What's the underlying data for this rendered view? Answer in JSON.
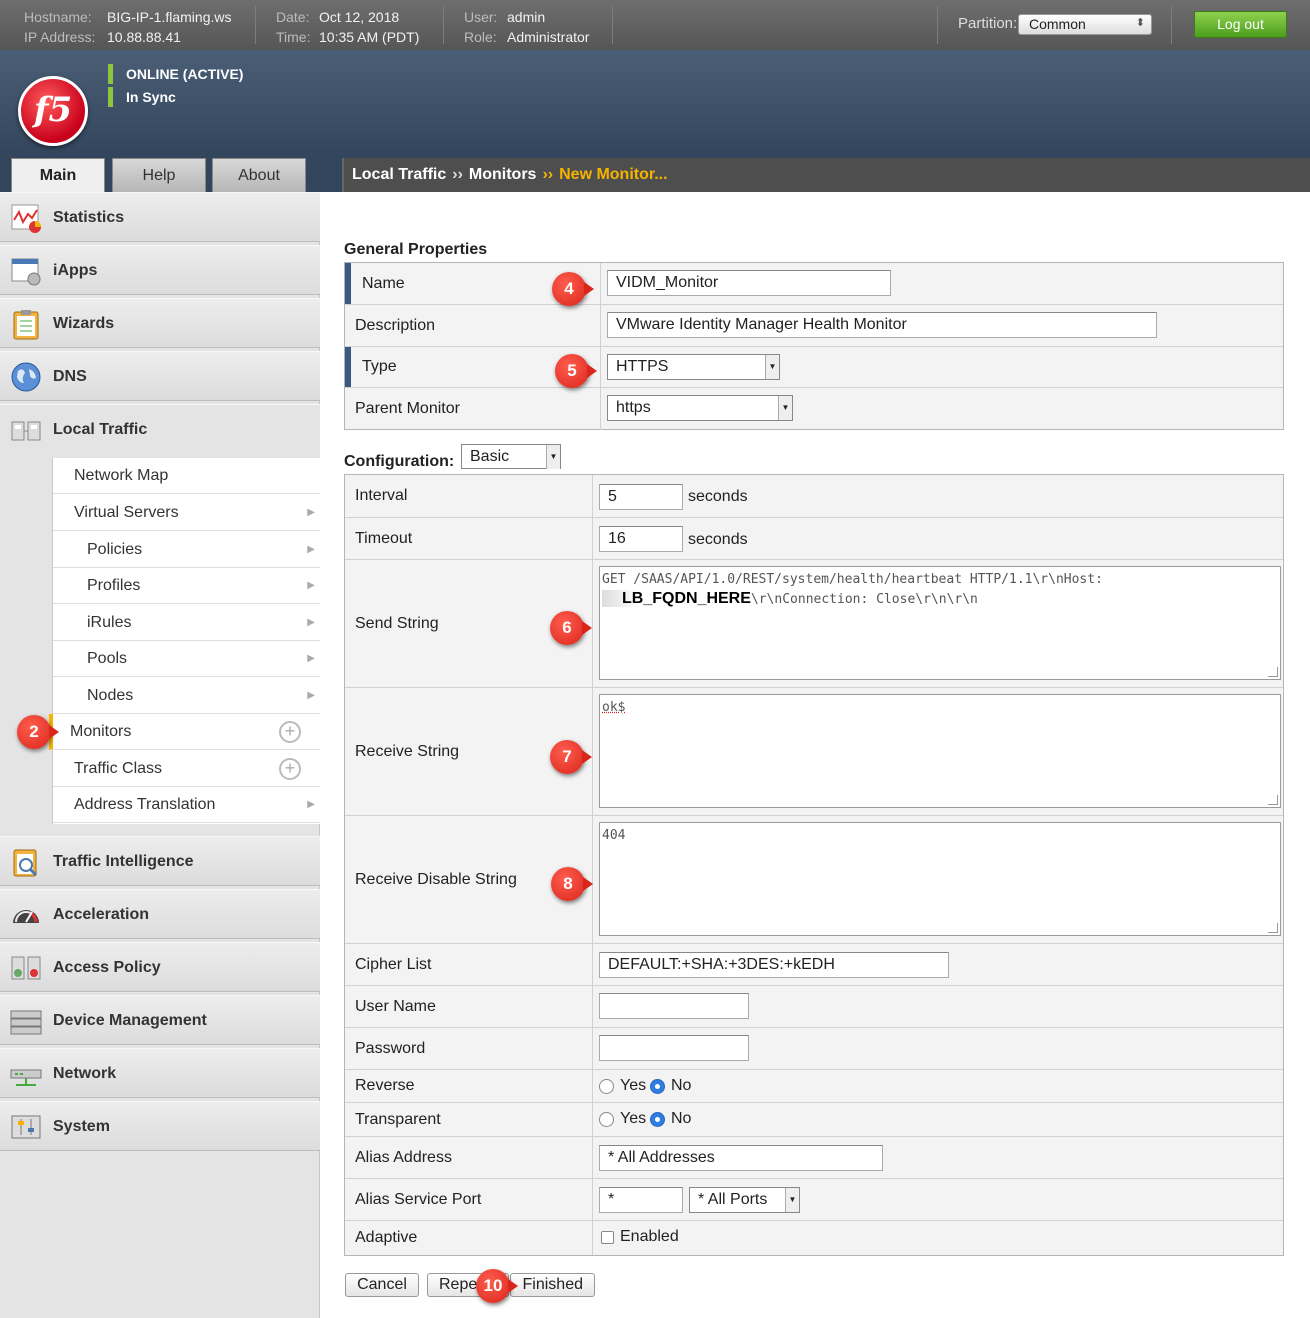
{
  "topbar": {
    "hostname_label": "Hostname:",
    "hostname": "BIG-IP-1.flaming.ws",
    "ip_label": "IP Address:",
    "ip": "10.88.88.41",
    "date_label": "Date:",
    "date": "Oct 12, 2018",
    "time_label": "Time:",
    "time": "10:35 AM (PDT)",
    "user_label": "User:",
    "user": "admin",
    "role_label": "Role:",
    "role": "Administrator",
    "partition_label": "Partition:",
    "partition": "Common",
    "logout": "Log out"
  },
  "header": {
    "logo": "f5",
    "status_online": "ONLINE (ACTIVE)",
    "status_sync": "In Sync",
    "status_color": "#8cc63f"
  },
  "tabs": [
    "Main",
    "Help",
    "About"
  ],
  "breadcrumb": {
    "a": "Local Traffic",
    "b": "Monitors",
    "c": "New Monitor...",
    "chev": "››"
  },
  "sidebar": {
    "items": [
      "Statistics",
      "iApps",
      "Wizards",
      "DNS",
      "Local Traffic",
      "Traffic Intelligence",
      "Acceleration",
      "Access Policy",
      "Device Management",
      "Network",
      "System"
    ],
    "local_traffic": [
      "Network Map",
      "Virtual Servers",
      "Policies",
      "Profiles",
      "iRules",
      "Pools",
      "Nodes",
      "Monitors",
      "Traffic Class",
      "Address Translation"
    ]
  },
  "badges": [
    "2",
    "4",
    "5",
    "6",
    "7",
    "8",
    "10"
  ],
  "general": {
    "title": "General Properties",
    "name_label": "Name",
    "name": "VIDM_Monitor",
    "desc_label": "Description",
    "desc": "VMware Identity Manager Health Monitor",
    "type_label": "Type",
    "type": "HTTPS",
    "parent_label": "Parent Monitor",
    "parent": "https"
  },
  "config": {
    "title": "Configuration:",
    "mode": "Basic",
    "interval_label": "Interval",
    "interval": "5",
    "timeout_label": "Timeout",
    "timeout": "16",
    "seconds": "seconds",
    "send_label": "Send String",
    "send_line1": "GET /SAAS/API/1.0/REST/system/health/heartbeat HTTP/1.1\\r\\nHost:",
    "send_fqdn": "LB_FQDN_HERE",
    "send_line2": "\\r\\nConnection: Close\\r\\n\\r\\n",
    "recv_label": "Receive String",
    "recv": "ok$",
    "recv_disable_label": "Receive Disable String",
    "recv_disable": "404",
    "cipher_label": "Cipher List",
    "cipher": "DEFAULT:+SHA:+3DES:+kEDH",
    "user_label": "User Name",
    "user": "",
    "pass_label": "Password",
    "pass": "",
    "reverse_label": "Reverse",
    "transparent_label": "Transparent",
    "yes": "Yes",
    "no": "No",
    "alias_addr_label": "Alias Address",
    "alias_addr": "* All Addresses",
    "alias_port_label": "Alias Service Port",
    "alias_port": "*",
    "alias_port_sel": "* All Ports",
    "adaptive_label": "Adaptive",
    "adaptive": "Enabled"
  },
  "buttons": {
    "cancel": "Cancel",
    "repeat": "Repe",
    "finished": "Finished"
  }
}
